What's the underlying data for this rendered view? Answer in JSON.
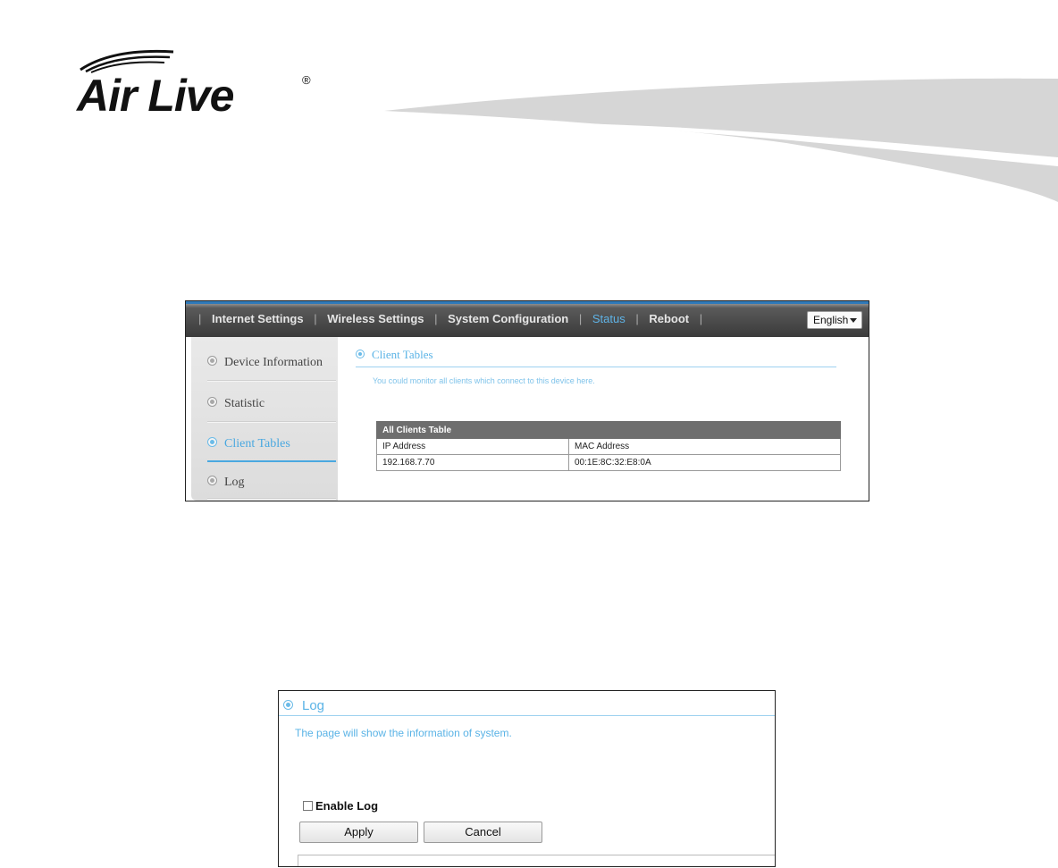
{
  "brand": {
    "logo_text": "Air Live",
    "registered": "®"
  },
  "screen1": {
    "nav": {
      "items": [
        "Internet Settings",
        "Wireless Settings",
        "System Configuration",
        "Status",
        "Reboot"
      ],
      "active": "Status",
      "language": "English"
    },
    "sidebar": {
      "items": [
        {
          "label": "Device Information"
        },
        {
          "label": "Statistic"
        },
        {
          "label": "Client Tables"
        },
        {
          "label": "Log"
        }
      ],
      "active": "Client Tables"
    },
    "content": {
      "title": "Client Tables",
      "description": "You could monitor all clients which connect to this device here.",
      "table": {
        "title": "All Clients Table",
        "headers": [
          "IP Address",
          "MAC Address"
        ],
        "rows": [
          [
            "192.168.7.70",
            "00:1E:8C:32:E8:0A"
          ]
        ]
      }
    }
  },
  "screen2": {
    "title": "Log",
    "description": "The page will show the information of system.",
    "enable_log": {
      "label": "Enable Log",
      "checked": false
    },
    "buttons": {
      "apply": "Apply",
      "cancel": "Cancel"
    }
  },
  "colors": {
    "accent": "#5ab3e6",
    "nav_bg": "#4a4a4a",
    "table_header_bg": "#6e6e6e"
  }
}
